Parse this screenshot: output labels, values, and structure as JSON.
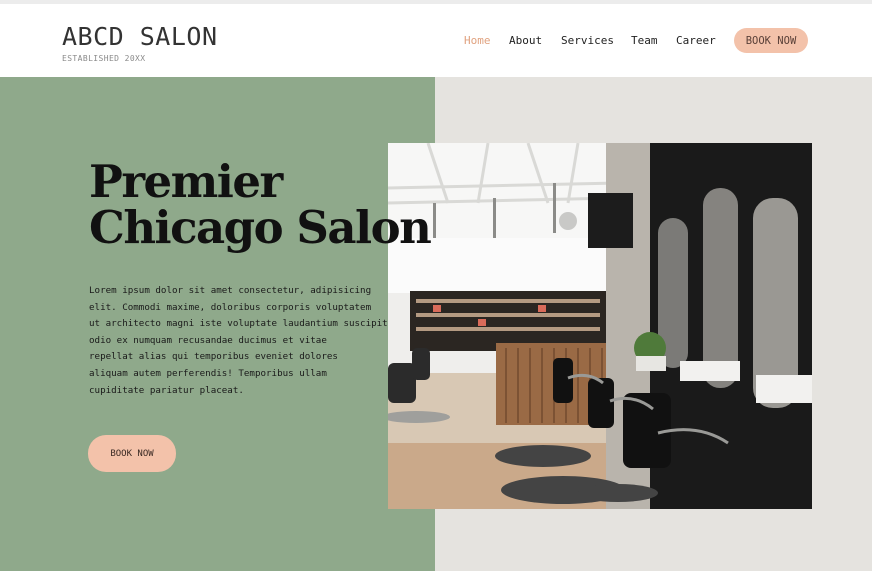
{
  "brand": {
    "name": "ABCD SALON",
    "tagline": "ESTABLISHED 20XX"
  },
  "nav": {
    "items": [
      {
        "label": "Home",
        "active": true
      },
      {
        "label": "About",
        "active": false
      },
      {
        "label": "Services",
        "active": false
      },
      {
        "label": "Team",
        "active": false
      },
      {
        "label": "Career",
        "active": false
      }
    ],
    "cta_label": "BOOK NOW"
  },
  "hero": {
    "title_line1": "Premier",
    "title_line2": "Chicago Salon",
    "body_lines": [
      "Lorem ipsum dolor sit amet consectetur, adipisicing",
      "elit. Commodi maxime, doloribus corporis voluptatem",
      "ut architecto magni iste voluptate laudantium suscipit",
      "odio ex numquam recusandae ducimus et vitae",
      "repellat alias qui temporibus eveniet dolores",
      "aliquam autem perferendis! Temporibus ullam",
      "cupiditate pariatur placeat."
    ],
    "cta_label": "BOOK NOW"
  },
  "colors": {
    "sage": "#8fa98b",
    "peach": "#f3c2aa",
    "accent_text": "#e0a27f",
    "light_panel": "#e5e3df"
  }
}
